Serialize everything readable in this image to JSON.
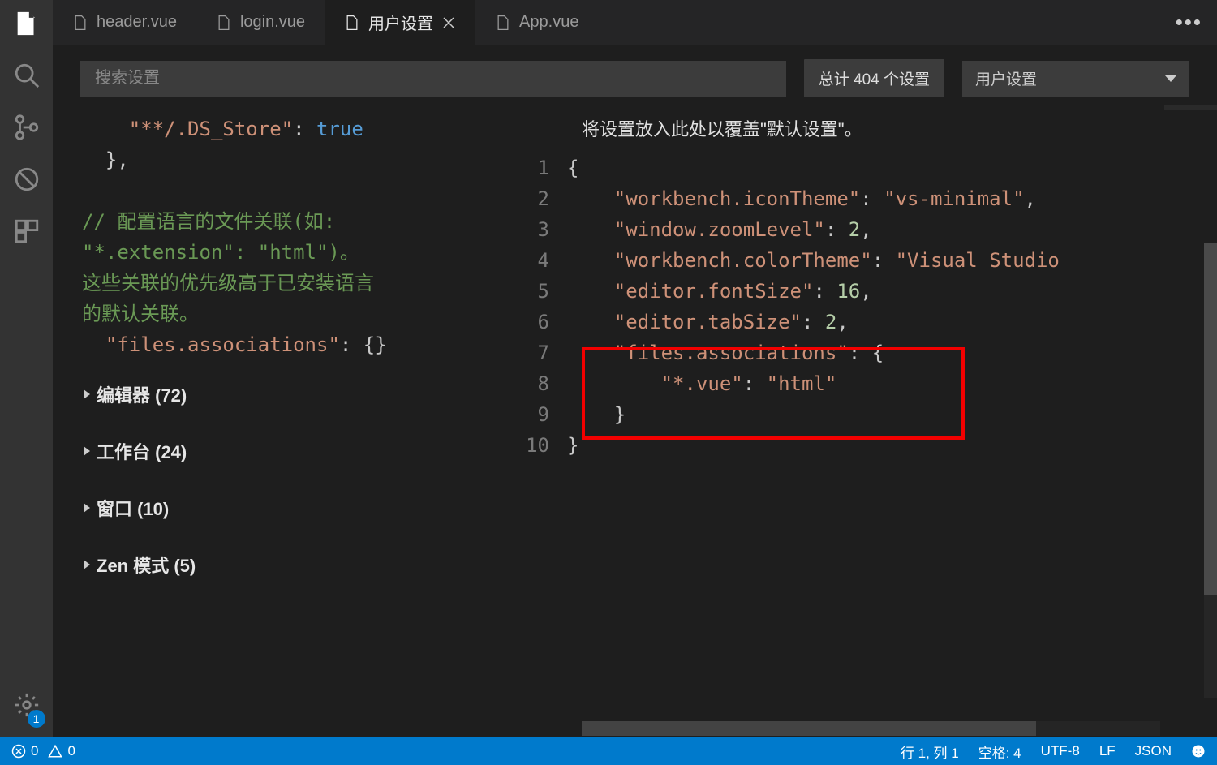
{
  "tabs": [
    {
      "label": "header.vue",
      "active": false
    },
    {
      "label": "login.vue",
      "active": false
    },
    {
      "label": "用户设置",
      "active": true
    },
    {
      "label": "App.vue",
      "active": false
    }
  ],
  "search": {
    "placeholder": "搜索设置"
  },
  "countText": "总计 404 个设置",
  "scopeDropdown": "用户设置",
  "leftEditor": {
    "dsStoreKey": "\"**/.DS_Store\"",
    "dsStoreValue": "true",
    "commentLines": "// 配置语言的文件关联(如:\n\"*.extension\": \"html\")。\n这些关联的优先级高于已安装语言\n的默认关联。",
    "assocKey": "\"files.associations\"",
    "assocVal": "{}"
  },
  "categories": [
    {
      "label": "编辑器 (72)"
    },
    {
      "label": "工作台 (24)"
    },
    {
      "label": "窗口 (10)"
    },
    {
      "label": "Zen 模式 (5)"
    }
  ],
  "rightCaption": "将设置放入此处以覆盖\"默认设置\"。",
  "rightCode": {
    "lineNumbers": [
      "1",
      "2",
      "3",
      "4",
      "5",
      "6",
      "7",
      "8",
      "9",
      "10"
    ],
    "lines": [
      {
        "raw": "{"
      },
      {
        "key": "\"workbench.iconTheme\"",
        "sep": ": ",
        "val": "\"vs-minimal\"",
        "trail": ","
      },
      {
        "key": "\"window.zoomLevel\"",
        "sep": ": ",
        "num": "2",
        "trail": ","
      },
      {
        "key": "\"workbench.colorTheme\"",
        "sep": ": ",
        "val": "\"Visual Studio"
      },
      {
        "key": "\"editor.fontSize\"",
        "sep": ": ",
        "num": "16",
        "trail": ","
      },
      {
        "key": "\"editor.tabSize\"",
        "sep": ": ",
        "num": "2",
        "trail": ","
      },
      {
        "key": "\"files.associations\"",
        "sep": ": ",
        "raw2": "{"
      },
      {
        "key2": "\"*.vue\"",
        "sep": ": ",
        "val": "\"html\""
      },
      {
        "raw": "    }"
      },
      {
        "raw": "}"
      }
    ]
  },
  "statusBar": {
    "errors": "0",
    "warnings": "0",
    "cursor": "行 1, 列 1",
    "spaces": "空格: 4",
    "encoding": "UTF-8",
    "eol": "LF",
    "lang": "JSON"
  },
  "gearBadge": "1"
}
